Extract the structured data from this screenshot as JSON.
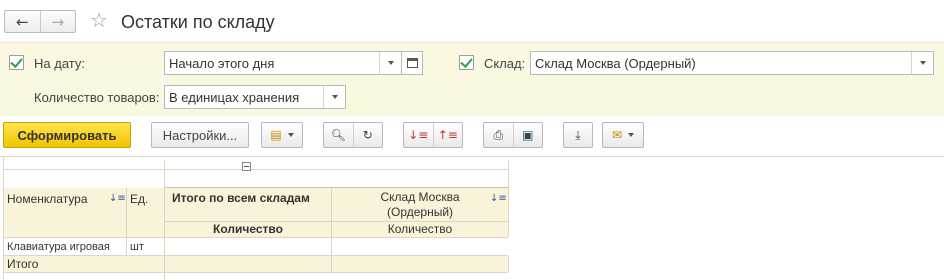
{
  "window": {
    "title": "Остатки по складу"
  },
  "params": {
    "date_label": "На дату:",
    "date_value": "Начало этого дня",
    "warehouse_label": "Склад:",
    "warehouse_value": "Склад Москва (Ордерный)",
    "qty_label": "Количество товаров:",
    "qty_value": "В единицах хранения"
  },
  "toolbar": {
    "generate_label": "Сформировать",
    "settings_label": "Настройки..."
  },
  "report": {
    "col_nomenclature": "Номенклатура",
    "col_unit": "Ед.",
    "col_total_all": "Итого по всем складам",
    "col_warehouse_line1": "Склад Москва",
    "col_warehouse_line2": "(Ордерный)",
    "sub_quantity_total": "Количество",
    "sub_quantity_wh": "Количество",
    "rows": [
      {
        "nomenclature": "Клавиатура игровая",
        "unit": "шт",
        "total": "",
        "warehouse": ""
      }
    ],
    "total_label": "Итого"
  },
  "colors": {
    "accent_yellow": "#f5cd1a",
    "params_bg": "#fbf8e1",
    "header_bg": "#f8f3d9",
    "check_green": "#2e9f4a"
  }
}
